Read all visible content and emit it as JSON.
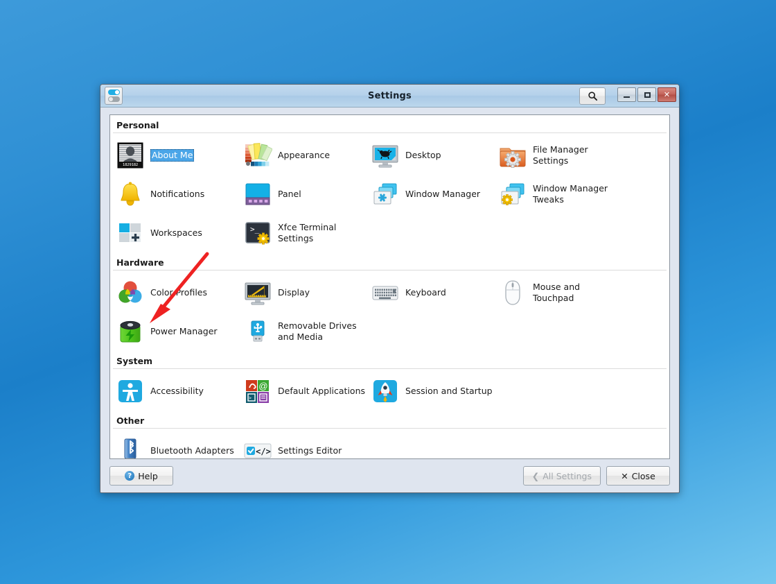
{
  "window": {
    "title": "Settings",
    "icon": "toggle-switch-icon",
    "search_button": "search-icon",
    "controls": {
      "minimize": "–",
      "maximize": "□",
      "close": "✕"
    }
  },
  "sections": [
    {
      "name": "Personal",
      "items": [
        {
          "label": "About Me",
          "icon": "mugshot-icon",
          "selected": true,
          "badge": "1829182"
        },
        {
          "label": "Appearance",
          "icon": "color-swatches-icon",
          "selected": false
        },
        {
          "label": "Desktop",
          "icon": "monitor-mouse-icon",
          "selected": false
        },
        {
          "label": "File Manager Settings",
          "icon": "folder-gear-orange-icon",
          "selected": false
        },
        {
          "label": "Notifications",
          "icon": "bell-icon",
          "selected": false
        },
        {
          "label": "Panel",
          "icon": "panel-icon",
          "selected": false
        },
        {
          "label": "Window Manager",
          "icon": "windows-star-icon",
          "selected": false
        },
        {
          "label": "Window Manager Tweaks",
          "icon": "windows-gear-icon",
          "selected": false
        },
        {
          "label": "Workspaces",
          "icon": "workspaces-grid-icon",
          "selected": false
        },
        {
          "label": "Xfce Terminal Settings",
          "icon": "terminal-gear-icon",
          "selected": false
        }
      ]
    },
    {
      "name": "Hardware",
      "items": [
        {
          "label": "Color Profiles",
          "icon": "color-circles-icon",
          "selected": false
        },
        {
          "label": "Display",
          "icon": "monitor-ruler-icon",
          "selected": false
        },
        {
          "label": "Keyboard",
          "icon": "keyboard-icon",
          "selected": false
        },
        {
          "label": "Mouse and Touchpad",
          "icon": "mouse-icon",
          "selected": false
        },
        {
          "label": "Power Manager",
          "icon": "battery-bolt-icon",
          "selected": false
        },
        {
          "label": "Removable Drives and Media",
          "icon": "usb-drive-icon",
          "selected": false
        }
      ]
    },
    {
      "name": "System",
      "items": [
        {
          "label": "Accessibility",
          "icon": "accessibility-person-icon",
          "selected": false
        },
        {
          "label": "Default Applications",
          "icon": "four-app-squares-icon",
          "selected": false
        },
        {
          "label": "Session and Startup",
          "icon": "rocket-icon",
          "selected": false
        }
      ]
    },
    {
      "name": "Other",
      "items": [
        {
          "label": "Bluetooth Adapters",
          "icon": "bluetooth-dongle-icon",
          "selected": false
        },
        {
          "label": "Settings Editor",
          "icon": "code-brackets-icon",
          "selected": false
        }
      ]
    }
  ],
  "buttons": {
    "help": "Help",
    "all_settings": "All Settings",
    "close": "Close",
    "all_settings_disabled": true
  },
  "annotation": {
    "type": "arrow",
    "color": "#ee2222",
    "points_to": "Power Manager"
  },
  "colors": {
    "desktop_blue": "#2e8fd4",
    "titlebar_blue": "#b4d1ea",
    "selection_blue": "#4ba6e8",
    "accent_red": "#ee2222"
  }
}
